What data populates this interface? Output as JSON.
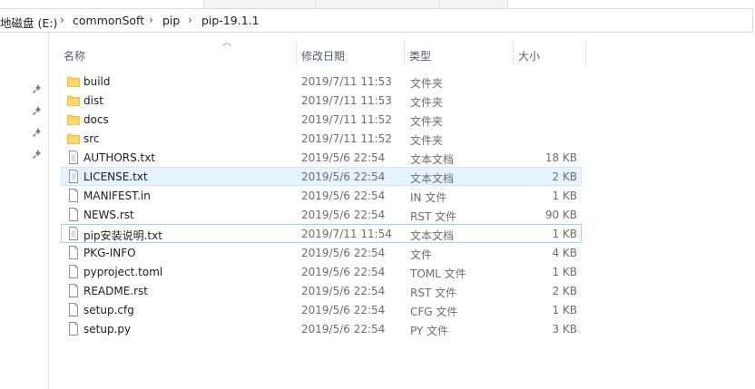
{
  "breadcrumb": {
    "items": [
      "地磁盘 (E:)",
      "commonSoft",
      "pip",
      "pip-19.1.1"
    ],
    "separator": "›"
  },
  "columns": {
    "name": "名称",
    "date": "修改日期",
    "type": "类型",
    "size": "大小"
  },
  "files": [
    {
      "name": "build",
      "date": "2019/7/11 11:53",
      "type": "文件夹",
      "size": "",
      "icon": "folder-icon"
    },
    {
      "name": "dist",
      "date": "2019/7/11 11:53",
      "type": "文件夹",
      "size": "",
      "icon": "folder-icon"
    },
    {
      "name": "docs",
      "date": "2019/7/11 11:52",
      "type": "文件夹",
      "size": "",
      "icon": "folder-icon"
    },
    {
      "name": "src",
      "date": "2019/7/11 11:52",
      "type": "文件夹",
      "size": "",
      "icon": "folder-icon"
    },
    {
      "name": "AUTHORS.txt",
      "date": "2019/5/6 22:54",
      "type": "文本文档",
      "size": "18 KB",
      "icon": "text-file-icon"
    },
    {
      "name": "LICENSE.txt",
      "date": "2019/5/6 22:54",
      "type": "文本文档",
      "size": "2 KB",
      "icon": "text-file-icon",
      "state": "selected"
    },
    {
      "name": "MANIFEST.in",
      "date": "2019/5/6 22:54",
      "type": "IN 文件",
      "size": "1 KB",
      "icon": "file-icon"
    },
    {
      "name": "NEWS.rst",
      "date": "2019/5/6 22:54",
      "type": "RST 文件",
      "size": "90 KB",
      "icon": "file-icon"
    },
    {
      "name": "pip安装说明.txt",
      "date": "2019/7/11 11:54",
      "type": "文本文档",
      "size": "1 KB",
      "icon": "text-file-icon",
      "state": "focused"
    },
    {
      "name": "PKG-INFO",
      "date": "2019/5/6 22:54",
      "type": "文件",
      "size": "4 KB",
      "icon": "file-icon"
    },
    {
      "name": "pyproject.toml",
      "date": "2019/5/6 22:54",
      "type": "TOML 文件",
      "size": "1 KB",
      "icon": "file-icon"
    },
    {
      "name": "README.rst",
      "date": "2019/5/6 22:54",
      "type": "RST 文件",
      "size": "2 KB",
      "icon": "file-icon"
    },
    {
      "name": "setup.cfg",
      "date": "2019/5/6 22:54",
      "type": "CFG 文件",
      "size": "1 KB",
      "icon": "file-icon"
    },
    {
      "name": "setup.py",
      "date": "2019/5/6 22:54",
      "type": "PY 文件",
      "size": "3 KB",
      "icon": "file-icon"
    }
  ],
  "colors": {
    "selected_bg": "#e5f3ff",
    "selected_border": "#cce8ff",
    "focused_border": "#99d1ff",
    "folder_yellow": "#ffd868",
    "header_text": "#4c607a"
  }
}
